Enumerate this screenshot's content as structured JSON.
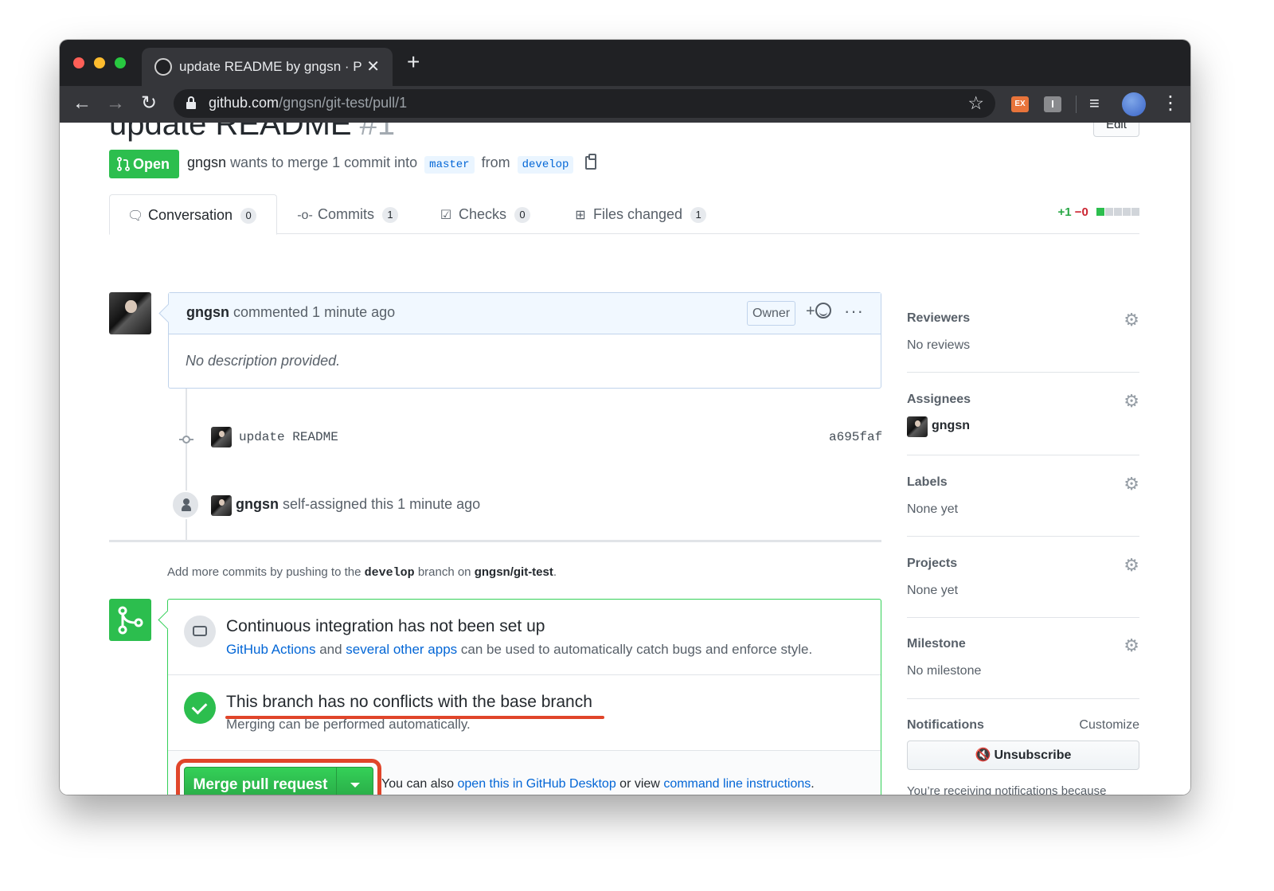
{
  "browser": {
    "tab_title": "update README by gngsn · Pull",
    "url_host": "github.com",
    "url_path": "/gngsn/git-test/pull/1",
    "ext_ex_label": "EX",
    "ext_i_label": "I"
  },
  "pr": {
    "title": "update README",
    "number": "#1",
    "edit_label": "Edit",
    "state": "Open",
    "author": "gngsn",
    "meta_text": "wants to merge 1 commit into",
    "base_branch": "master",
    "from_text": "from",
    "head_branch": "develop"
  },
  "tabs": [
    {
      "label": "Conversation",
      "count": "0"
    },
    {
      "label": "Commits",
      "count": "1"
    },
    {
      "label": "Checks",
      "count": "0"
    },
    {
      "label": "Files changed",
      "count": "1"
    }
  ],
  "diffstat": {
    "additions": "+1",
    "deletions": "−0"
  },
  "comment": {
    "author": "gngsn",
    "action": "commented 1 minute ago",
    "badge": "Owner",
    "reaction": "+",
    "more": "···",
    "body": "No description provided."
  },
  "timeline": {
    "commit_message": "update README",
    "commit_sha": "a695faf",
    "assign_author": "gngsn",
    "assign_text": "self-assigned this 1 minute ago"
  },
  "push_hint": {
    "prefix": "Add more commits by pushing to the",
    "branch": "develop",
    "middle": "branch on",
    "repo": "gngsn/git-test",
    "suffix": "."
  },
  "merge": {
    "ci_title": "Continuous integration has not been set up",
    "ci_link1": "GitHub Actions",
    "ci_and": "and",
    "ci_link2": "several other apps",
    "ci_suffix": "can be used to automatically catch bugs and enforce style.",
    "conflict_title": "This branch has no conflicts with the base branch",
    "conflict_desc": "Merging can be performed automatically.",
    "merge_button": "Merge pull request",
    "also_prefix": "You can also",
    "also_link1": "open this in GitHub Desktop",
    "also_middle": "or view",
    "also_link2": "command line instructions",
    "also_suffix": "."
  },
  "sidebar": {
    "reviewers": {
      "heading": "Reviewers",
      "value": "No reviews"
    },
    "assignees": {
      "heading": "Assignees",
      "value": "gngsn"
    },
    "labels": {
      "heading": "Labels",
      "value": "None yet"
    },
    "projects": {
      "heading": "Projects",
      "value": "None yet"
    },
    "milestone": {
      "heading": "Milestone",
      "value": "No milestone"
    },
    "notifications": {
      "heading": "Notifications",
      "customize": "Customize",
      "button": "Unsubscribe",
      "reason": "You’re receiving notifications because you’re watching this repository."
    }
  },
  "colors": {
    "success_green": "#2cbe4e",
    "link_blue": "#0366d6",
    "annotation_red": "#e0452a"
  }
}
